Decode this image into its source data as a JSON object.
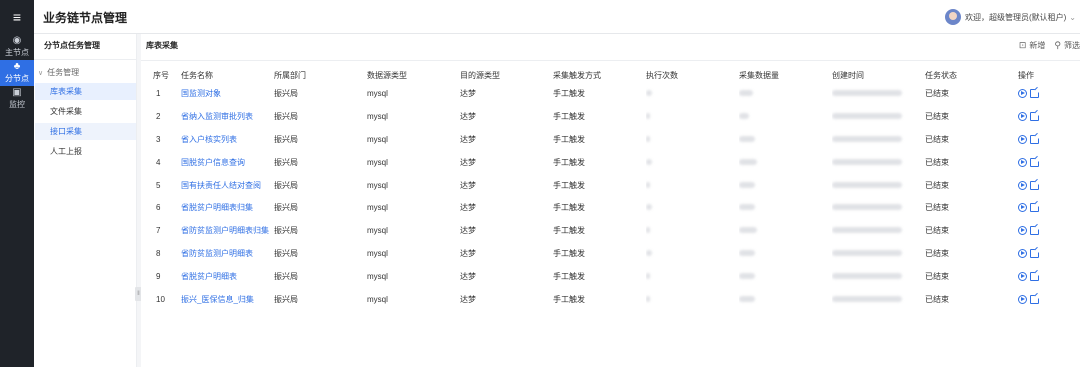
{
  "rail": {
    "menu_icon": "hamburger-icon",
    "items": [
      {
        "label": "主节点",
        "icon": "target-icon"
      },
      {
        "label": "分节点",
        "icon": "network-icon"
      },
      {
        "label": "监控",
        "icon": "monitor-icon"
      }
    ],
    "active_index": 1
  },
  "topbar": {
    "title": "业务链节点管理",
    "user_text": "欢迎，超级管理员(默认租户)"
  },
  "left_panel": {
    "title": "分节点任务管理",
    "group": "任务管理",
    "items": [
      "库表采集",
      "文件采集",
      "接口采集",
      "人工上报"
    ]
  },
  "content": {
    "title": "库表采集",
    "actions": {
      "add": "新增",
      "filter": "筛选"
    }
  },
  "table": {
    "headers": [
      "序号",
      "任务名称",
      "所属部门",
      "数据源类型",
      "目的源类型",
      "采集触发方式",
      "执行次数",
      "采集数据量",
      "创建时间",
      "任务状态",
      "操作"
    ],
    "rows": [
      {
        "no": "1",
        "name": "国监测对象",
        "dept": "振兴局",
        "src": "mysql",
        "dst": "达梦",
        "trigger": "手工触发",
        "status": "已结束"
      },
      {
        "no": "2",
        "name": "省纳入监测审批列表",
        "dept": "振兴局",
        "src": "mysql",
        "dst": "达梦",
        "trigger": "手工触发",
        "status": "已结束"
      },
      {
        "no": "3",
        "name": "省入户核实列表",
        "dept": "振兴局",
        "src": "mysql",
        "dst": "达梦",
        "trigger": "手工触发",
        "status": "已结束"
      },
      {
        "no": "4",
        "name": "国脱贫户信息查询",
        "dept": "振兴局",
        "src": "mysql",
        "dst": "达梦",
        "trigger": "手工触发",
        "status": "已结束"
      },
      {
        "no": "5",
        "name": "国有扶责任人结对查阅",
        "dept": "振兴局",
        "src": "mysql",
        "dst": "达梦",
        "trigger": "手工触发",
        "status": "已结束"
      },
      {
        "no": "6",
        "name": "省脱贫户明细表归集",
        "dept": "振兴局",
        "src": "mysql",
        "dst": "达梦",
        "trigger": "手工触发",
        "status": "已结束"
      },
      {
        "no": "7",
        "name": "省防贫监测户明细表归集",
        "dept": "振兴局",
        "src": "mysql",
        "dst": "达梦",
        "trigger": "手工触发",
        "status": "已结束"
      },
      {
        "no": "8",
        "name": "省防贫监测户明细表",
        "dept": "振兴局",
        "src": "mysql",
        "dst": "达梦",
        "trigger": "手工触发",
        "status": "已结束"
      },
      {
        "no": "9",
        "name": "省脱贫户明细表",
        "dept": "振兴局",
        "src": "mysql",
        "dst": "达梦",
        "trigger": "手工触发",
        "status": "已结束"
      },
      {
        "no": "10",
        "name": "振兴_医保信息_归集",
        "dept": "振兴局",
        "src": "mysql",
        "dst": "达梦",
        "trigger": "手工触发",
        "status": "已结束"
      }
    ]
  },
  "colors": {
    "accent": "#2f6fe4",
    "rail_bg": "#1f2329"
  }
}
